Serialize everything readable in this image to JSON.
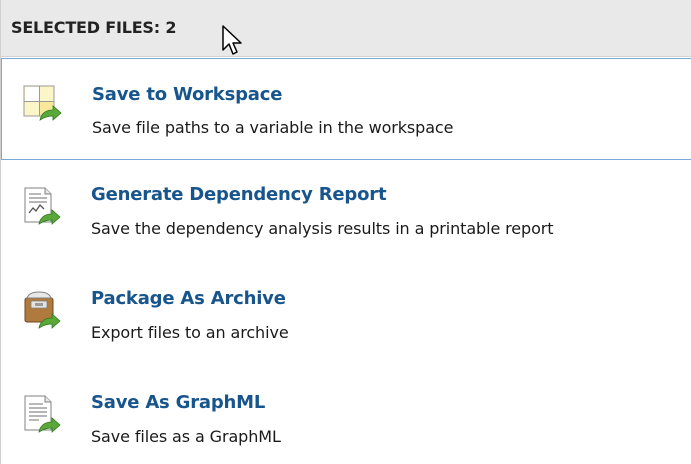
{
  "header": {
    "text": "SELECTED FILES: 2"
  },
  "items": [
    {
      "title": "Save to Workspace",
      "description": "Save file paths to a variable in the workspace",
      "icon": "workspace-save-icon",
      "selected": true
    },
    {
      "title": "Generate Dependency Report",
      "description": "Save the dependency analysis results in a printable report",
      "icon": "report-icon",
      "selected": false
    },
    {
      "title": "Package As Archive",
      "description": "Export files to an archive",
      "icon": "archive-icon",
      "selected": false
    },
    {
      "title": "Save As GraphML",
      "description": "Save files as a GraphML",
      "icon": "graphml-file-icon",
      "selected": false
    }
  ],
  "colors": {
    "title": "#17558c",
    "header_bg": "#e9e9e9",
    "selection_border": "#78a8d8",
    "arrow_green": "#5aa83a"
  }
}
